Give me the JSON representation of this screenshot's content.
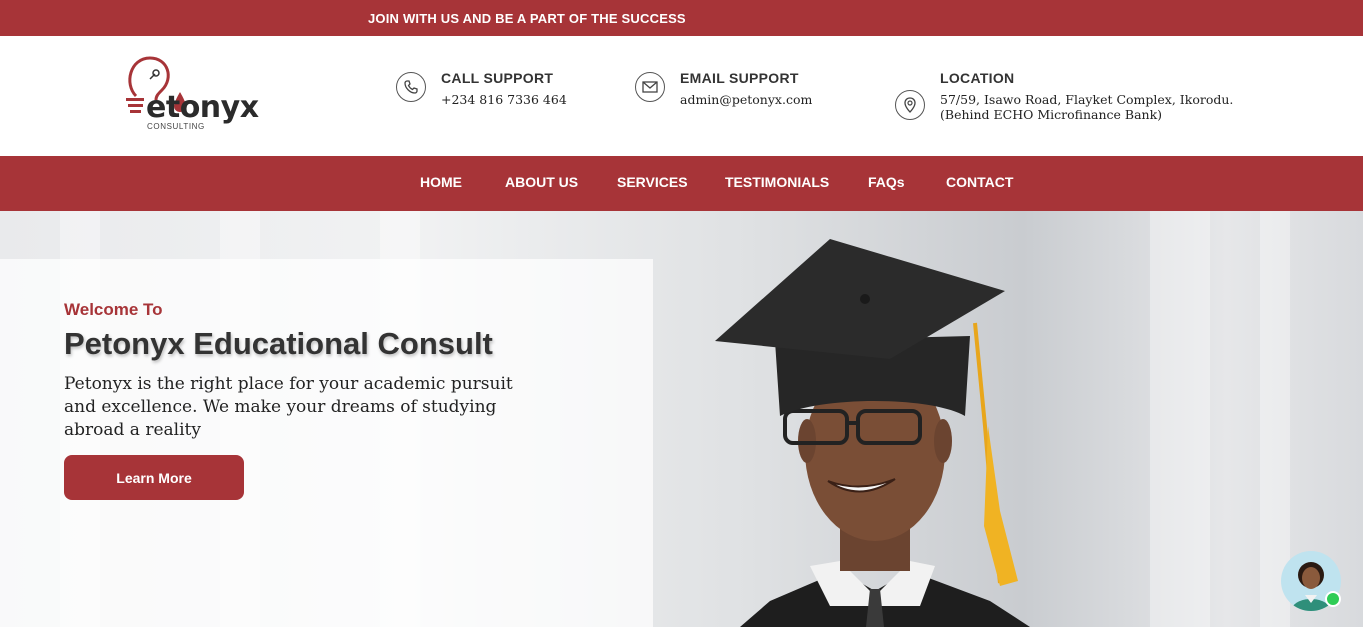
{
  "topbar": {
    "text": "JOIN WITH US AND BE A PART OF THE SUCCESS"
  },
  "logo": {
    "word": "etonyx",
    "sub": "CONSULTING"
  },
  "contacts": [
    {
      "title": "CALL SUPPORT",
      "value": "+234 816 7336 464",
      "icon": "phone-icon"
    },
    {
      "title": "EMAIL SUPPORT",
      "value": "admin@petonyx.com",
      "icon": "envelope-icon"
    },
    {
      "title": "LOCATION",
      "value": "57/59, Isawo Road, Flayket Complex, Ikorodu.",
      "value2": "(Behind ECHO Microfinance Bank)",
      "icon": "location-pin-icon"
    }
  ],
  "nav": {
    "items": [
      "HOME",
      "ABOUT US",
      "SERVICES",
      "TESTIMONIALS",
      "FAQs",
      "CONTACT"
    ]
  },
  "hero": {
    "welcome": "Welcome To",
    "title": "Petonyx Educational Consult",
    "description": "Petonyx is the right place for your academic pursuit and excellence. We make your dreams of studying abroad a reality",
    "button": "Learn More"
  },
  "colors": {
    "brand": "#a73438",
    "online": "#2ecc55"
  }
}
